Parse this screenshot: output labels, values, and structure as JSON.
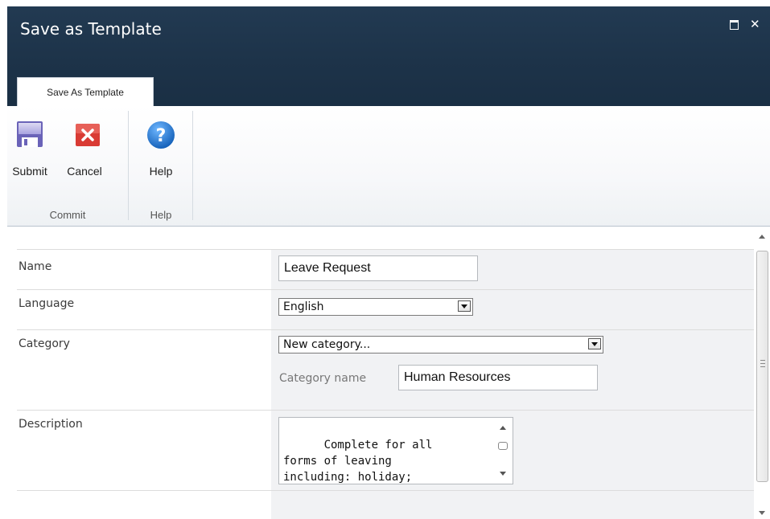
{
  "window": {
    "title": "Save as Template",
    "maximize_icon": "maximize-icon",
    "close_icon": "close-icon",
    "close_glyph": "✕"
  },
  "ribbon": {
    "tab_label": "Save As Template",
    "groups": [
      {
        "label": "Commit",
        "buttons": [
          {
            "label": "Submit",
            "icon": "save-icon"
          },
          {
            "label": "Cancel",
            "icon": "cancel-icon"
          }
        ]
      },
      {
        "label": "Help",
        "buttons": [
          {
            "label": "Help",
            "icon": "help-icon"
          }
        ]
      }
    ],
    "help_glyph": "?",
    "cancel_glyph": "✕"
  },
  "form": {
    "name": {
      "label": "Name",
      "value": "Leave Request"
    },
    "language": {
      "label": "Language",
      "selected": "English"
    },
    "category": {
      "label": "Category",
      "selected": "New category...",
      "sub_label": "Category name",
      "sub_value": "Human Resources"
    },
    "description": {
      "label": "Description",
      "value": "Complete for all\nforms of leaving\nincluding: holiday;"
    }
  },
  "colors": {
    "title_bar": "#1d3349",
    "form_right_column": "#f1f2f4"
  }
}
